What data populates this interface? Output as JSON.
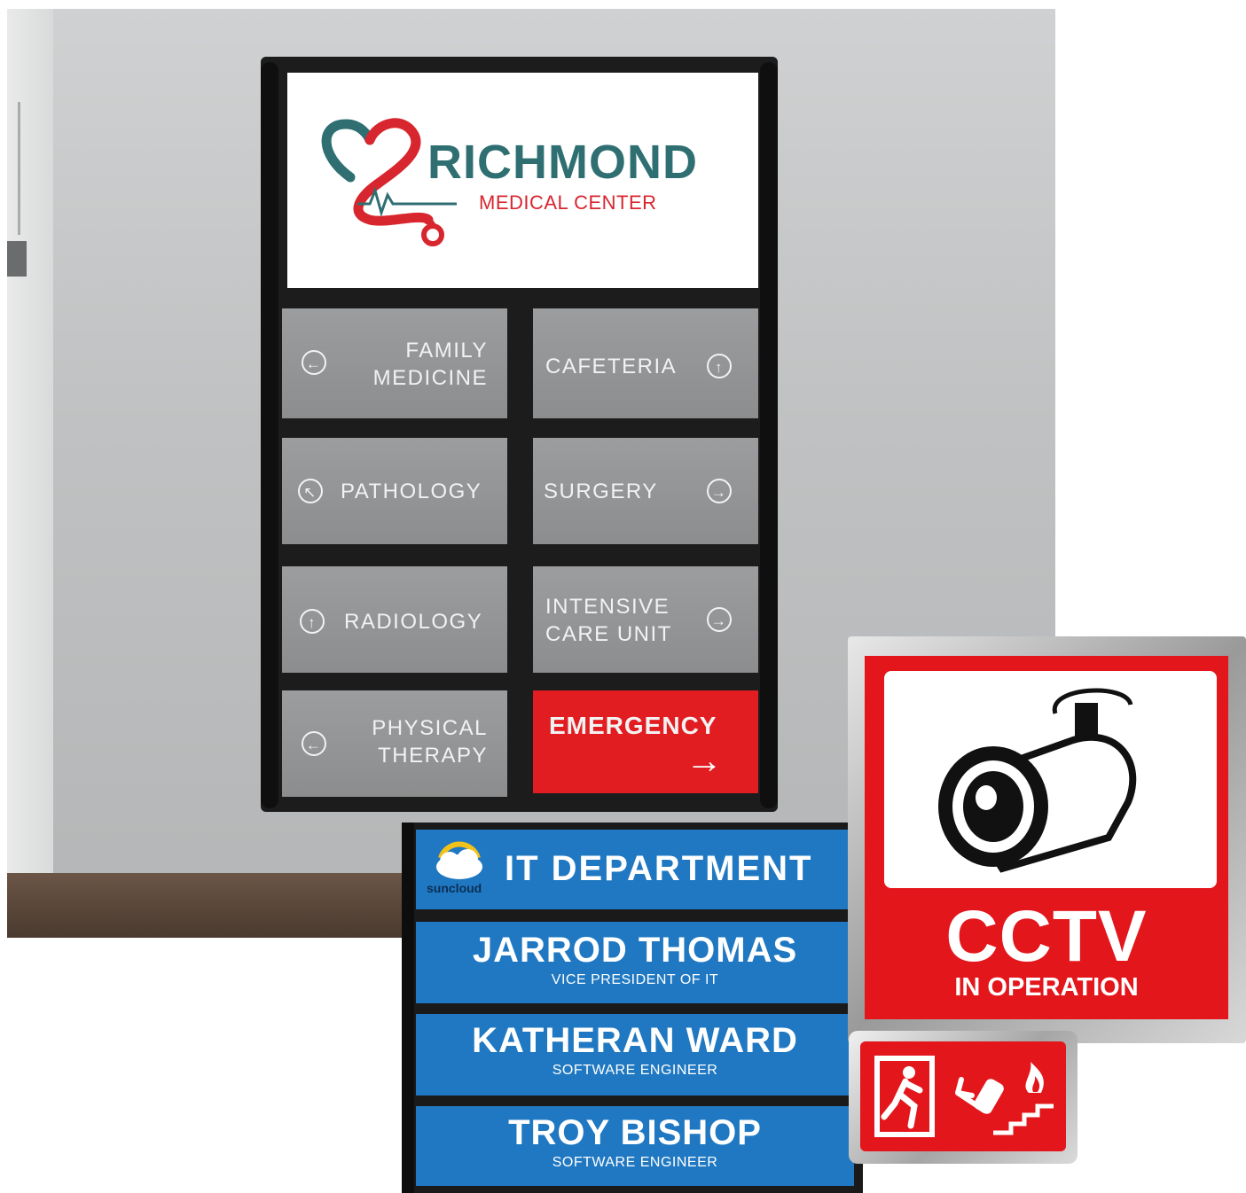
{
  "main_sign": {
    "brand_name": "RICHMOND",
    "brand_sub": "MEDICAL CENTER",
    "brand_colors": {
      "teal": "#2f6f72",
      "red": "#d8262f"
    },
    "slots": [
      {
        "text": "FAMILY\nMEDICINE",
        "icon": "arrow-left-icon"
      },
      {
        "text": "CAFETERIA",
        "icon": "arrow-up-icon"
      },
      {
        "text": "PATHOLOGY",
        "icon": "arrow-up-left-icon"
      },
      {
        "text": "SURGERY",
        "icon": "arrow-right-icon"
      },
      {
        "text": "RADIOLOGY",
        "icon": "arrow-up-icon"
      },
      {
        "text": "INTENSIVE\nCARE UNIT",
        "icon": "arrow-right-icon"
      },
      {
        "text": "PHYSICAL\nTHERAPY",
        "icon": "arrow-left-icon"
      },
      {
        "text": "EMERGENCY",
        "icon": "arrow-right-icon",
        "color": "#e21d21"
      }
    ]
  },
  "it_board": {
    "logo_text": "suncloud",
    "header": "IT DEPARTMENT",
    "people": [
      {
        "name": "JARROD THOMAS",
        "role": "VICE PRESIDENT OF IT"
      },
      {
        "name": "KATHERAN WARD",
        "role": "SOFTWARE ENGINEER"
      },
      {
        "name": "TROY BISHOP",
        "role": "SOFTWARE ENGINEER"
      }
    ],
    "panel_color": "#1f78c1"
  },
  "cctv_sign": {
    "title": "CCTV",
    "subtitle": "IN OPERATION",
    "icon": "security-camera-icon",
    "color": "#e3161b"
  },
  "fire_sign": {
    "icons": [
      "running-person-exit-icon",
      "fire-extinguisher-icon",
      "stairs-icon",
      "flame-icon"
    ],
    "color": "#e3161b"
  }
}
